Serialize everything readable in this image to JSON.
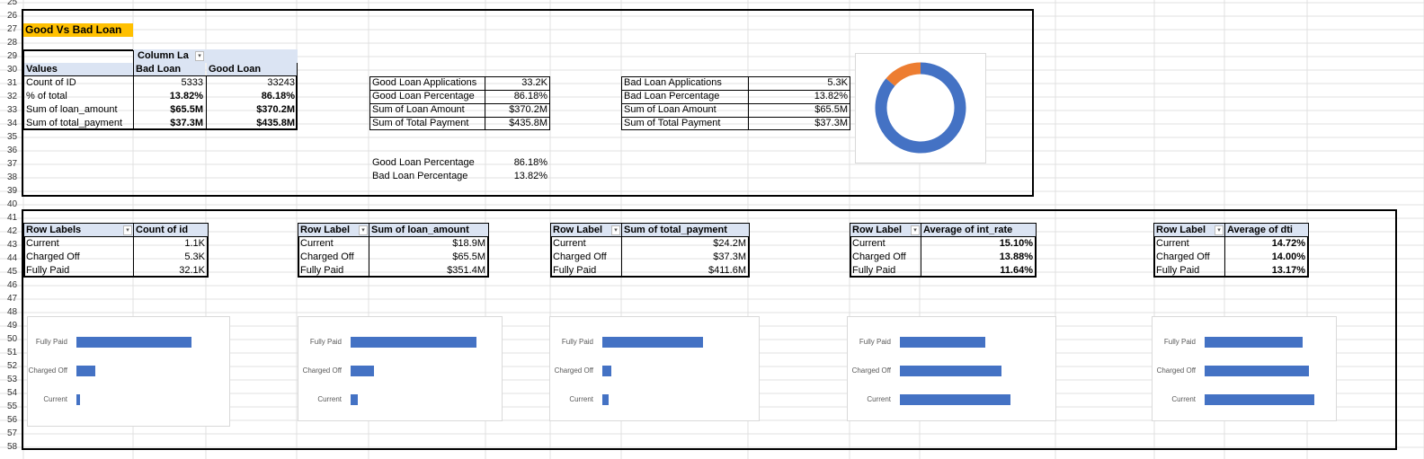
{
  "rows": [
    "25",
    "26",
    "27",
    "28",
    "29",
    "30",
    "31",
    "32",
    "33",
    "34",
    "35",
    "36",
    "37",
    "38",
    "39",
    "40",
    "41",
    "42",
    "43",
    "44",
    "45",
    "46",
    "47",
    "48",
    "49",
    "50",
    "51",
    "52",
    "53",
    "54",
    "55",
    "56",
    "57",
    "58"
  ],
  "title": "Good Vs Bad Loan",
  "colors": {
    "accent": "#ffc000",
    "bar": "#4472c4",
    "donut_main": "#4472c4",
    "donut_slice": "#ed7d31",
    "header": "#dbe4f3"
  },
  "pivot": {
    "column_labels": "Column La",
    "values_label": "Values",
    "col_bad": "Bad Loan",
    "col_good": "Good Loan",
    "rows": [
      {
        "label": "Count of ID",
        "bad": "5333",
        "good": "33243"
      },
      {
        "label": "% of total",
        "bad": "13.82%",
        "good": "86.18%"
      },
      {
        "label": "Sum of loan_amount",
        "bad": "$65.5M",
        "good": "$370.2M"
      },
      {
        "label": "Sum of total_payment",
        "bad": "$37.3M",
        "good": "$435.8M"
      }
    ]
  },
  "good_summary": [
    {
      "label": "Good Loan Applications",
      "value": "33.2K"
    },
    {
      "label": "Good Loan Percentage",
      "value": "86.18%"
    },
    {
      "label": "Sum of Loan Amount",
      "value": "$370.2M"
    },
    {
      "label": "Sum of Total Payment",
      "value": "$435.8M"
    }
  ],
  "bad_summary": [
    {
      "label": "Bad Loan Applications",
      "value": "5.3K"
    },
    {
      "label": "Bad Loan Percentage",
      "value": "13.82%"
    },
    {
      "label": "Sum of Loan Amount",
      "value": "$65.5M"
    },
    {
      "label": "Sum of Total Payment",
      "value": "$37.3M"
    }
  ],
  "pct_lines": [
    {
      "label": "Good Loan Percentage",
      "value": "86.18%"
    },
    {
      "label": "Bad Loan Percentage",
      "value": "13.82%"
    }
  ],
  "status_tables": [
    {
      "rowlabel": "Row Labels",
      "measure": "Count of id",
      "rows": [
        {
          "label": "Current",
          "value": "1.1K"
        },
        {
          "label": "Charged Off",
          "value": "5.3K"
        },
        {
          "label": "Fully Paid",
          "value": "32.1K"
        }
      ],
      "bold": false
    },
    {
      "rowlabel": "Row Label",
      "measure": "Sum of loan_amount",
      "rows": [
        {
          "label": "Current",
          "value": "$18.9M"
        },
        {
          "label": "Charged Off",
          "value": "$65.5M"
        },
        {
          "label": "Fully Paid",
          "value": "$351.4M"
        }
      ],
      "bold": false
    },
    {
      "rowlabel": "Row Label",
      "measure": "Sum of total_payment",
      "rows": [
        {
          "label": "Current",
          "value": "$24.2M"
        },
        {
          "label": "Charged Off",
          "value": "$37.3M"
        },
        {
          "label": "Fully Paid",
          "value": "$411.6M"
        }
      ],
      "bold": false
    },
    {
      "rowlabel": "Row Label",
      "measure": "Average of int_rate",
      "rows": [
        {
          "label": "Current",
          "value": "15.10%"
        },
        {
          "label": "Charged Off",
          "value": "13.88%"
        },
        {
          "label": "Fully Paid",
          "value": "11.64%"
        }
      ],
      "bold": true
    },
    {
      "rowlabel": "Row Label",
      "measure": "Average of dti",
      "rows": [
        {
          "label": "Current",
          "value": "14.72%"
        },
        {
          "label": "Charged Off",
          "value": "14.00%"
        },
        {
          "label": "Fully Paid",
          "value": "13.17%"
        }
      ],
      "bold": true
    }
  ],
  "chart_data": [
    {
      "type": "pie",
      "categories": [
        "Good Loan",
        "Bad Loan"
      ],
      "values": [
        86.18,
        13.82
      ]
    },
    {
      "type": "bar",
      "categories": [
        "Fully Paid",
        "Charged Off",
        "Current"
      ],
      "values": [
        32.1,
        5.3,
        1.1
      ]
    },
    {
      "type": "bar",
      "categories": [
        "Fully Paid",
        "Charged Off",
        "Current"
      ],
      "values": [
        351.4,
        65.5,
        18.9
      ]
    },
    {
      "type": "bar",
      "categories": [
        "Fully Paid",
        "Charged Off",
        "Current"
      ],
      "values": [
        411.6,
        37.3,
        24.2
      ]
    },
    {
      "type": "bar",
      "categories": [
        "Fully Paid",
        "Charged Off",
        "Current"
      ],
      "values": [
        11.64,
        13.88,
        15.1
      ]
    },
    {
      "type": "bar",
      "categories": [
        "Fully Paid",
        "Charged Off",
        "Current"
      ],
      "values": [
        13.17,
        14.0,
        14.72
      ]
    }
  ]
}
